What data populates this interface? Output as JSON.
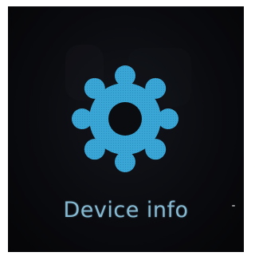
{
  "screen": {
    "label": "Device info",
    "icon": "gear-icon",
    "colors": {
      "background": "#0a0b0f",
      "icon": "#3aa6d6",
      "icon_hole": "#0b0c10",
      "label": "#86b9d2"
    }
  }
}
